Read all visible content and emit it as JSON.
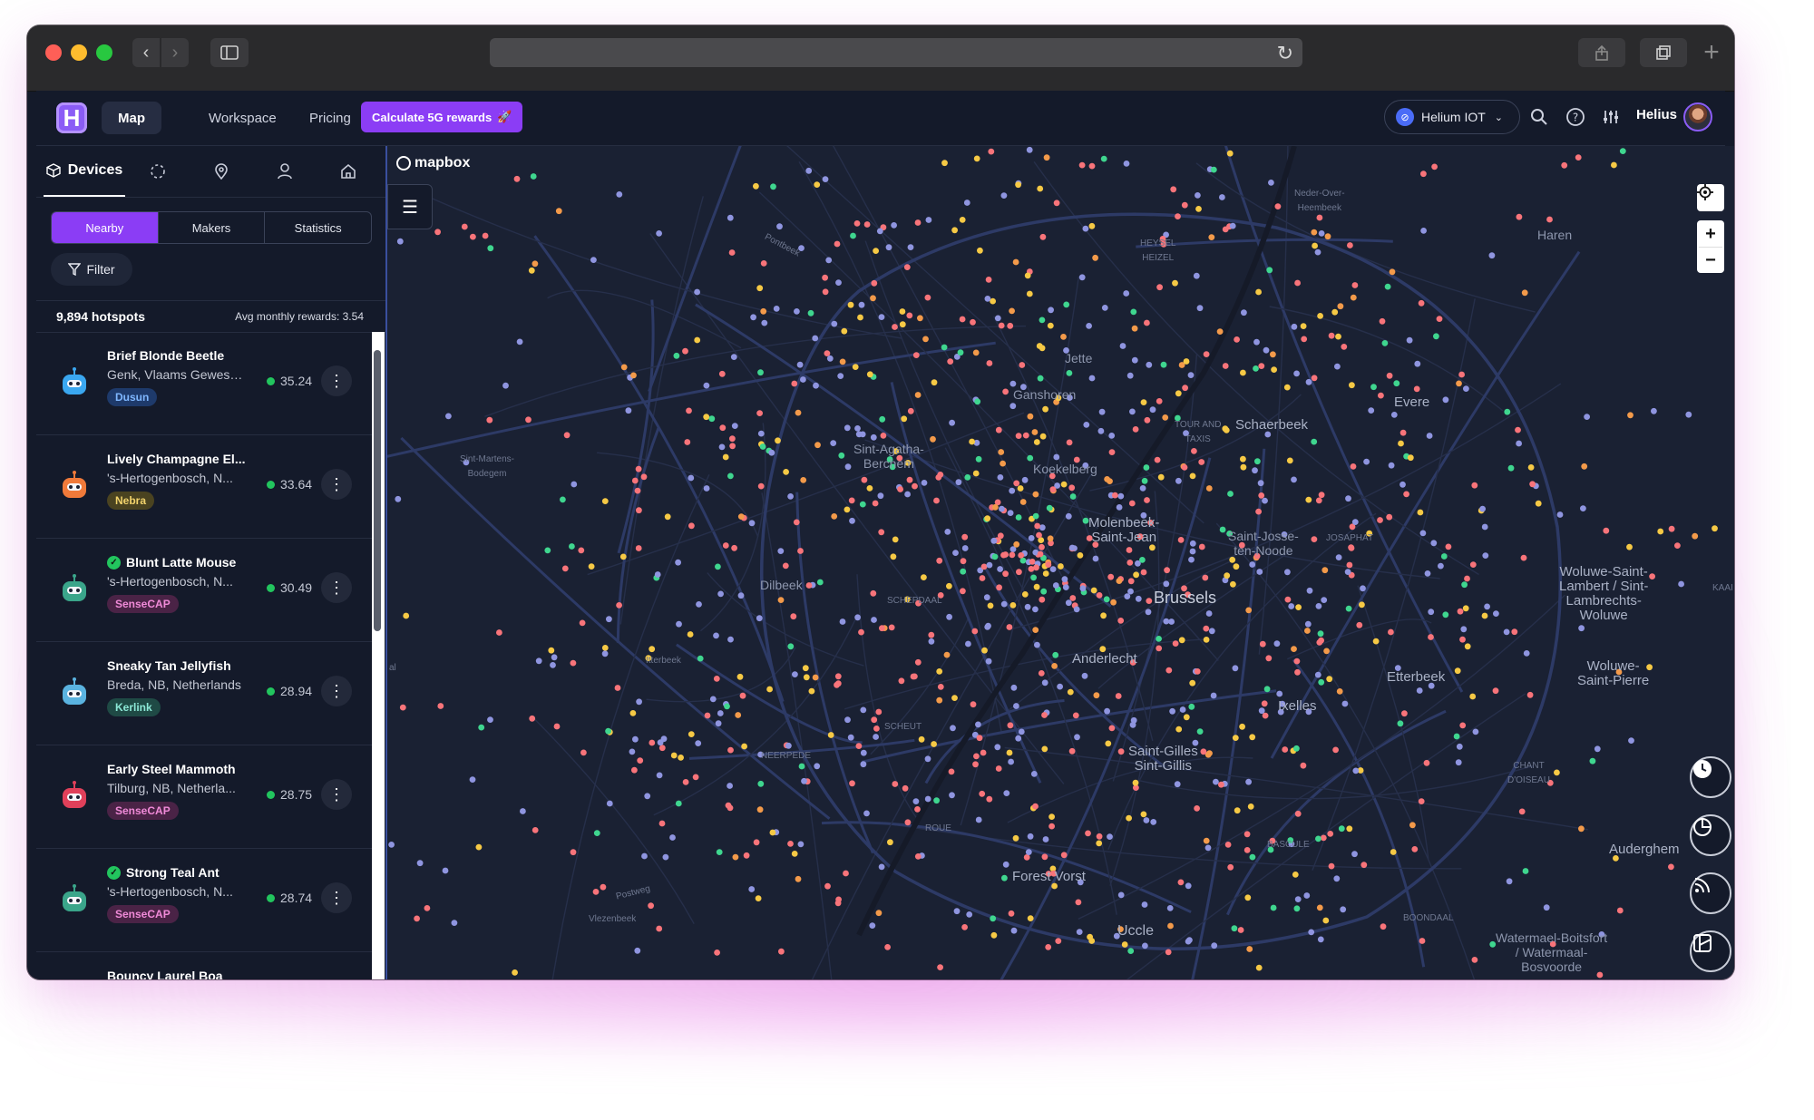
{
  "browser": {
    "back_icon": "chevron-left-icon",
    "forward_icon": "chevron-right-icon",
    "sidebar_icon": "sidebar-icon",
    "reload_icon": "reload-icon",
    "share_icon": "share-icon",
    "tabs_icon": "tabs-icon",
    "new_tab_icon": "plus-icon"
  },
  "header": {
    "logo_letter": "H",
    "nav": [
      {
        "label": "Map",
        "active": true
      },
      {
        "label": "Workspace",
        "active": false
      },
      {
        "label": "Pricing",
        "active": false
      }
    ],
    "cta_label": "Calculate 5G rewards",
    "cta_emoji": "🚀",
    "network": "Helium IOT",
    "user": "Helius",
    "icons": [
      "search-icon",
      "help-icon",
      "settings-sliders-icon"
    ]
  },
  "sidebar": {
    "tabs": [
      {
        "label": "Devices",
        "icon": "cube-icon",
        "active": true
      },
      {
        "label": "",
        "icon": "spinner-icon"
      },
      {
        "label": "",
        "icon": "pin-icon"
      },
      {
        "label": "",
        "icon": "user-icon"
      },
      {
        "label": "",
        "icon": "home-icon"
      }
    ],
    "segments": [
      "Nearby",
      "Makers",
      "Statistics"
    ],
    "active_segment": "Nearby",
    "filter_label": "Filter",
    "hotspot_count": "9,894 hotspots",
    "avg_rewards": "Avg monthly rewards: 3.54",
    "items": [
      {
        "name": "Brief Blonde Beetle",
        "location": "Genk, Vlaams Gewest...",
        "maker": "Dusun",
        "reward": "35.24",
        "verified": false,
        "avatar_color": "#3aa7f0",
        "badge_bg": "#1e3a6b",
        "badge_fg": "#7fb7ff"
      },
      {
        "name": "Lively Champagne El...",
        "location": "'s-Hertogenbosch, N...",
        "maker": "Nebra",
        "reward": "33.64",
        "verified": false,
        "avatar_color": "#f07a3a",
        "badge_bg": "#4a4320",
        "badge_fg": "#f2d36b"
      },
      {
        "name": "Blunt Latte Mouse",
        "location": "'s-Hertogenbosch, N...",
        "maker": "SenseCAP",
        "reward": "30.49",
        "verified": true,
        "avatar_color": "#3aa58a",
        "badge_bg": "#4a2346",
        "badge_fg": "#f08ad8"
      },
      {
        "name": "Sneaky Tan Jellyfish",
        "location": "Breda, NB, Netherlands",
        "maker": "Kerlink",
        "reward": "28.94",
        "verified": false,
        "avatar_color": "#5ab3e0",
        "badge_bg": "#1f4a45",
        "badge_fg": "#8ce8d6"
      },
      {
        "name": "Early Steel Mammoth",
        "location": "Tilburg, NB, Netherla...",
        "maker": "SenseCAP",
        "reward": "28.75",
        "verified": false,
        "avatar_color": "#e0405a",
        "badge_bg": "#4a2346",
        "badge_fg": "#f08ad8"
      },
      {
        "name": "Strong Teal Ant",
        "location": "'s-Hertogenbosch, N...",
        "maker": "SenseCAP",
        "reward": "28.74",
        "verified": true,
        "avatar_color": "#3aa58a",
        "badge_bg": "#4a2346",
        "badge_fg": "#f08ad8"
      },
      {
        "name": "Bouncy Laurel Boa",
        "location": "",
        "maker": "",
        "reward": "",
        "verified": false,
        "avatar_color": "#8a8fa0",
        "badge_bg": "#1f2638",
        "badge_fg": "#cccccc"
      }
    ]
  },
  "map": {
    "attribution": "mapbox",
    "labels": {
      "brussels": "Brussels",
      "schaerbeek": "Schaerbeek",
      "evere": "Evere",
      "haren": "Haren",
      "jette": "Jette",
      "ganshoren": "Ganshoren",
      "koekelberg": "Koekelberg",
      "sint_agatha": "Sint-Agatha-\nBerchem",
      "molenbeek": "Molenbeek-\nSaint-Jean",
      "saint_josse": "Saint-Josse-\nten-Noode",
      "woluwe_lambert": "Woluwe-Saint-\nLambert / Sint-\nLambrechts-\nWoluwe",
      "woluwe_pierre": "Woluwe-\nSaint-Pierre",
      "dilbeek": "Dilbeek",
      "anderlecht": "Anderlecht",
      "etterbeek": "Etterbeek",
      "ixelles": "Ixelles",
      "saint_gilles": "Saint-Gilles\nSint-Gillis",
      "forest": "Forest Vorst",
      "uccle": "Uccle",
      "auderghem": "Auderghem",
      "watermael": "Watermael-Boitsfort\n/ Watermaal-\nBosvoorde",
      "sint_martens": "Sint-Martens-\nBodegem",
      "heysel": "HEYSEL\nHEIZEL",
      "neerpede": "NEERPEDE",
      "scheut": "SCHEUT",
      "boondael": "BOONDAAL",
      "tour_taxis": "TOUR AND\nTAXIS",
      "pontbeek": "Pontbeek",
      "postweg": "Postweg",
      "vlezenbeek": "Vlezenbeek",
      "itterbeek": "Itterbeek",
      "schepdaal": "SCHEPDAAL",
      "kaai": "KAAI",
      "neder": "Neder-Over-\nHeembeek",
      "chant": "CHANT\nD'OISEAU",
      "roue": "ROUE",
      "bascule": "BASCULE",
      "josaphat": "JOSAPHAT",
      "edge_a": "al"
    },
    "controls": {
      "locate_icon": "locate-icon",
      "zoom_in": "+",
      "zoom_out": "−",
      "menu_icon": "menu-icon",
      "right_buttons": [
        "clock-icon",
        "pie-chart-icon",
        "rss-icon",
        "layers-icon"
      ]
    },
    "dot_colors": [
      "#f8747a",
      "#8f95e0",
      "#f6c945",
      "#3fd68f",
      "#f39a4a"
    ]
  }
}
